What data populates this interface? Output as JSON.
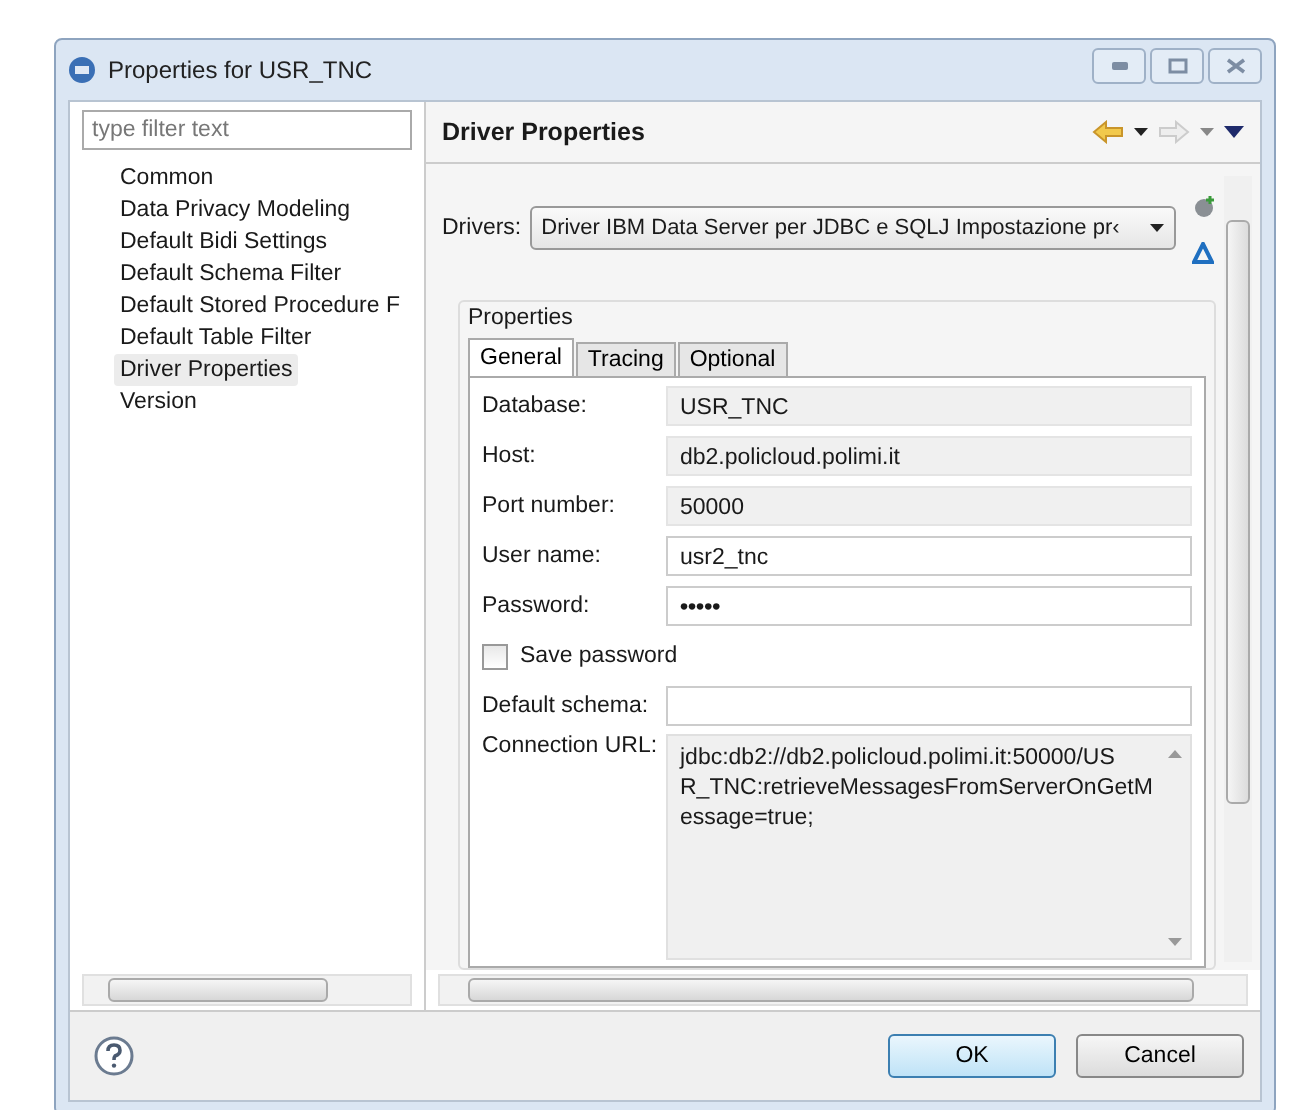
{
  "window": {
    "title": "Properties for USR_TNC"
  },
  "filter": {
    "placeholder": "type filter text"
  },
  "sidebar": {
    "items": [
      {
        "label": "Common",
        "selected": false
      },
      {
        "label": "Data Privacy Modeling",
        "selected": false
      },
      {
        "label": "Default Bidi Settings",
        "selected": false
      },
      {
        "label": "Default Schema Filter",
        "selected": false
      },
      {
        "label": "Default Stored Procedure F",
        "selected": false
      },
      {
        "label": "Default Table Filter",
        "selected": false
      },
      {
        "label": "Driver Properties",
        "selected": true
      },
      {
        "label": "Version",
        "selected": false
      }
    ]
  },
  "page": {
    "title": "Driver Properties",
    "drivers_label": "Drivers:",
    "driver": "Driver IBM Data Server per JDBC e SQLJ Impostazione pr‹",
    "group": "Properties",
    "tabs": [
      {
        "label": "General",
        "selected": true
      },
      {
        "label": "Tracing",
        "selected": false
      },
      {
        "label": "Optional",
        "selected": false
      }
    ],
    "fields": [
      {
        "label": "Database:",
        "value": "USR_TNC",
        "kind": "readonly"
      },
      {
        "label": "Host:",
        "value": "db2.policloud.polimi.it",
        "kind": "readonly"
      },
      {
        "label": "Port number:",
        "value": "50000",
        "kind": "readonly"
      },
      {
        "label": "User name:",
        "value": "usr2_tnc",
        "kind": "text"
      },
      {
        "label": "Password:",
        "value": "•••••",
        "kind": "password"
      },
      {
        "label": "Save password",
        "checked": false,
        "kind": "checkbox"
      },
      {
        "label": "Default schema:",
        "kind": "text"
      }
    ],
    "url": {
      "label": "Connection URL:",
      "lines": [
        "jdbc:db2://db2.policloud.polimi.it:50000/US",
        "R_TNC:retrieveMessagesFromServerOnGetM",
        "essage=true;"
      ]
    }
  },
  "buttons": [
    {
      "label": "OK",
      "kind": "default"
    },
    {
      "label": "Cancel",
      "kind": "normal"
    }
  ]
}
